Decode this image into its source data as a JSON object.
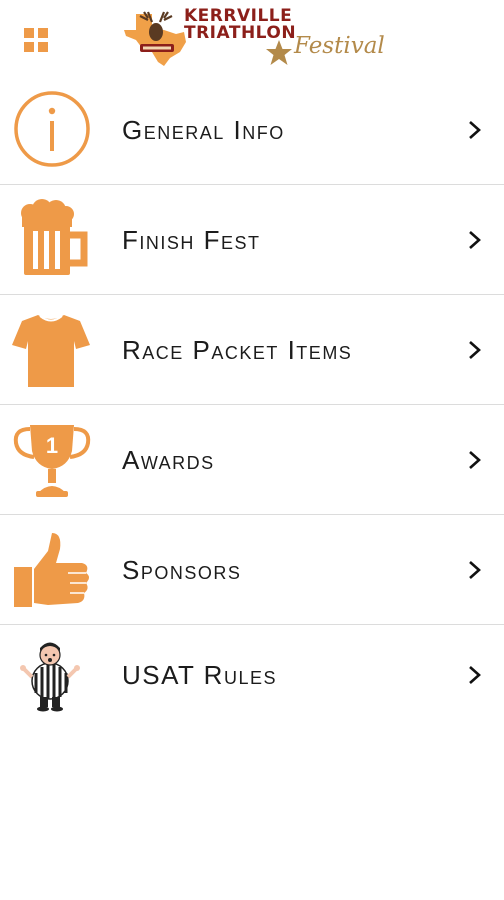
{
  "brand": {
    "accent": "#EE9A48",
    "logo_color": "#8C1F1A",
    "line1": "KERRVILLE",
    "line2": "TRIATHLON",
    "line3": "Festival"
  },
  "menu": [
    {
      "label": "General Info",
      "icon": "info-icon"
    },
    {
      "label": "Finish Fest",
      "icon": "beer-mug-icon"
    },
    {
      "label": "Race Packet Items",
      "icon": "shirt-icon"
    },
    {
      "label": "Awards",
      "icon": "trophy-icon"
    },
    {
      "label": "Sponsors",
      "icon": "thumbs-up-icon"
    },
    {
      "label": "USAT Rules",
      "icon": "referee-icon"
    }
  ]
}
